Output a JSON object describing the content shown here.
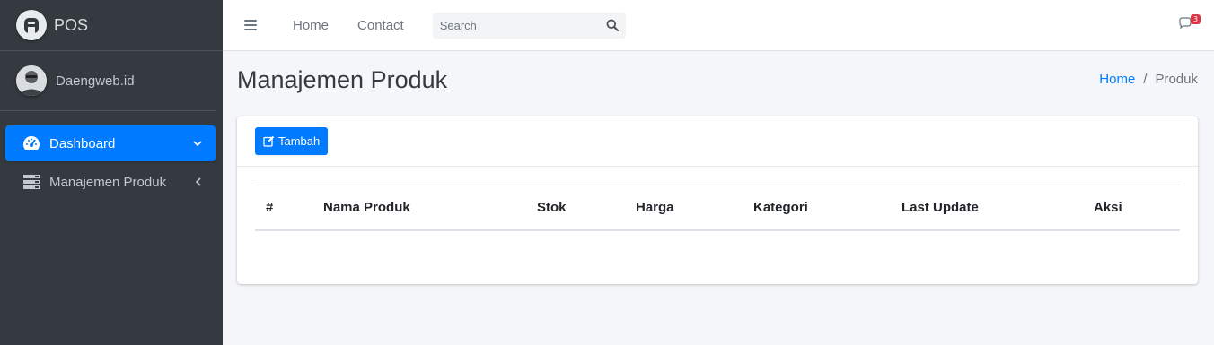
{
  "brand": {
    "name": "POS"
  },
  "user": {
    "name": "Daengweb.id"
  },
  "sidebar": {
    "items": [
      {
        "label": "Dashboard",
        "icon": "tachometer-icon",
        "active": true
      },
      {
        "label": "Manajemen Produk",
        "icon": "server-icon",
        "active": false
      }
    ]
  },
  "navbar": {
    "links": [
      "Home",
      "Contact"
    ],
    "search": {
      "placeholder": "Search"
    },
    "messages_badge": "3"
  },
  "page": {
    "title": "Manajemen Produk"
  },
  "breadcrumb": {
    "home": "Home",
    "separator": "/",
    "current": "Produk"
  },
  "card": {
    "add_button": "Tambah"
  },
  "table": {
    "columns": [
      "#",
      "Nama Produk",
      "Stok",
      "Harga",
      "Kategori",
      "Last Update",
      "Aksi"
    ],
    "rows": []
  },
  "colors": {
    "sidebar_bg": "#343a40",
    "primary": "#007bff",
    "badge": "#dc3545",
    "content_bg": "#f4f6f9"
  }
}
